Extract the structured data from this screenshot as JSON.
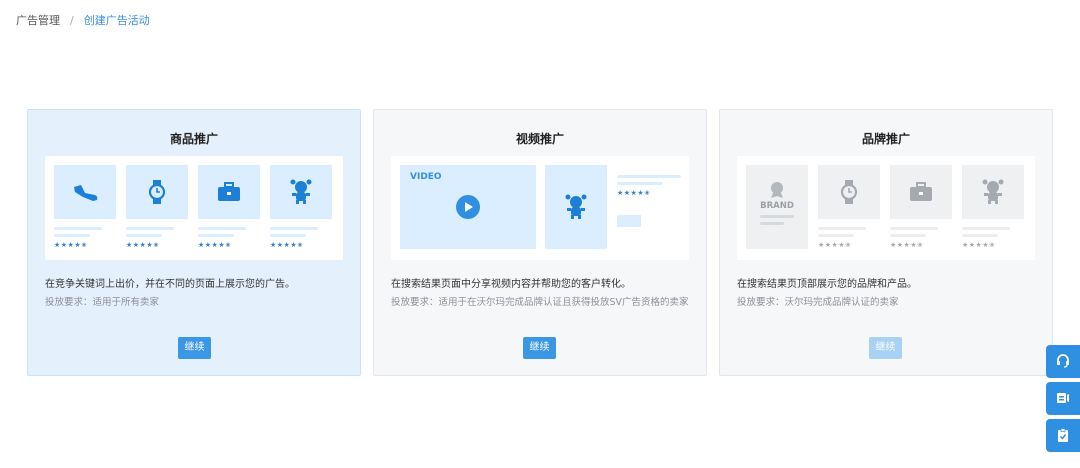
{
  "breadcrumb": {
    "root": "广告管理",
    "separator": "/",
    "current": "创建广告活动"
  },
  "cards": [
    {
      "title": "商品推广",
      "description": "在竞争关键词上出价，并在不同的页面上展示您的广告。",
      "requirement": "投放要求：适用于所有卖家",
      "button": "继续",
      "state": "selected"
    },
    {
      "title": "视频推广",
      "description": "在搜索结果页面中分享视频内容并帮助您的客户转化。",
      "requirement": "投放要求：适用于在沃尔玛完成品牌认证且获得投放SV广告资格的卖家",
      "button": "继续",
      "state": "default"
    },
    {
      "title": "品牌推广",
      "description": "在搜索结果页顶部展示您的品牌和产品。",
      "requirement": "投放要求：沃尔玛完成品牌认证的卖家",
      "button": "继续",
      "state": "disabled"
    }
  ],
  "preview": {
    "video_label": "VIDEO",
    "brand_label": "BRAND",
    "stars": "★★★★✬"
  },
  "icons": [
    "shoe-icon",
    "watch-icon",
    "briefcase-icon",
    "toy-icon",
    "play-icon",
    "headset-icon",
    "message-icon",
    "clipboard-icon"
  ],
  "colors": {
    "accent": "#3b97e4",
    "selected_bg": "#e4f1fd",
    "tile_blue": "#dbeeff",
    "tile_gray": "#eef0f2"
  }
}
